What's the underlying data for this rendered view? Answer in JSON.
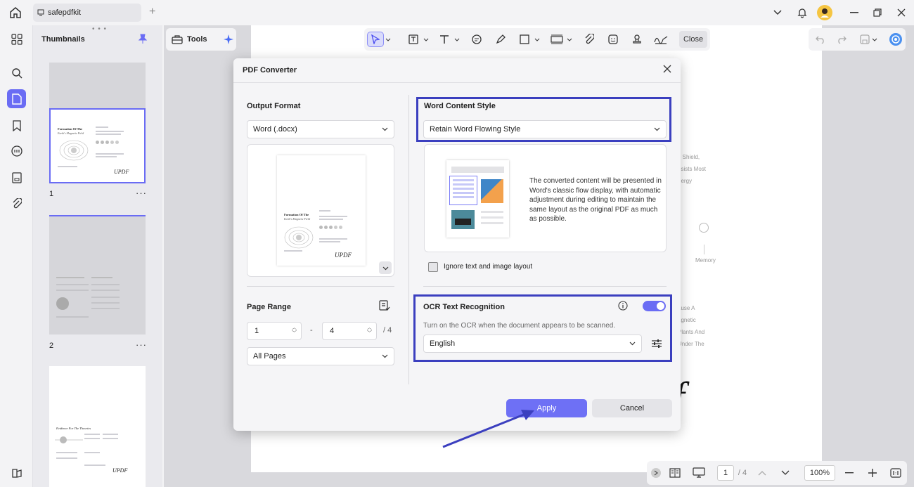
{
  "tab": {
    "title": "safepdfkit"
  },
  "thumbnails": {
    "title": "Thumbnails",
    "pages": [
      {
        "num": "1",
        "heading": "Formation Of The",
        "subheading": "Earth's Magnetic Field",
        "signature": "UPDF"
      },
      {
        "num": "2"
      },
      {
        "heading": "Evidence For The Theories",
        "signature": "UPDF"
      }
    ]
  },
  "toolbar": {
    "tools_label": "Tools",
    "close_label": "Close"
  },
  "background_text": {
    "right": [
      "e Shield,",
      "esists Most",
      "nergy",
      "e",
      "Memory",
      "ause A",
      "agnetic",
      "Plants And",
      "Under The"
    ],
    "signature_fragment": "f"
  },
  "bottom_nav": {
    "page": "1",
    "total": "/ 4",
    "zoom": "100%"
  },
  "dialog": {
    "title": "PDF Converter",
    "output_format": {
      "label": "Output Format",
      "value": "Word (.docx)"
    },
    "preview": {
      "heading": "Formation Of The",
      "subheading": "Earth's Magnetic Field",
      "signature": "UPDF"
    },
    "page_range": {
      "label": "Page Range",
      "from": "1",
      "separator": "-",
      "to": "4",
      "total": "/ 4",
      "pages_value": "All Pages"
    },
    "word_style": {
      "label": "Word Content Style",
      "value": "Retain Word Flowing Style",
      "description": "The converted content will be presented in Word's classic flow display, with automatic adjustment during editing to maintain the same layout as the original PDF as much as possible."
    },
    "ignore_layout": {
      "label": "Ignore text and image layout",
      "checked": false
    },
    "ocr": {
      "label": "OCR Text Recognition",
      "enabled": true,
      "hint": "Turn on the OCR when the document appears to be scanned.",
      "language": "English"
    },
    "apply_label": "Apply",
    "cancel_label": "Cancel"
  },
  "colors": {
    "accent": "#6a6cf4",
    "highlight": "#3b3fbf",
    "apply": "#6e70f5"
  }
}
